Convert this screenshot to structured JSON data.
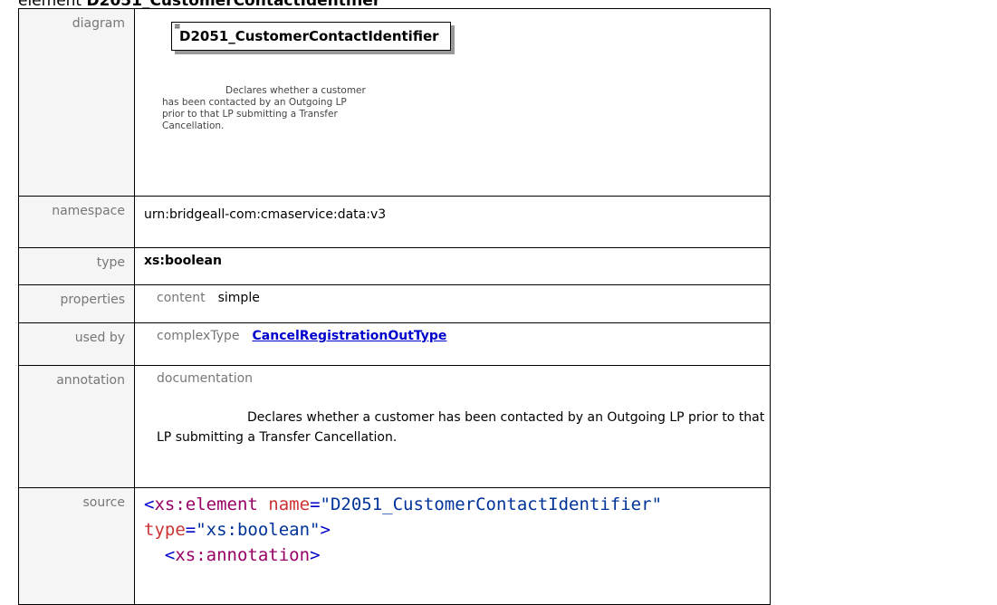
{
  "heading": {
    "prefix": "element ",
    "name": "D2051_CustomerContactIdentifier"
  },
  "rows": {
    "diagram": {
      "label": "diagram",
      "element_name": "D2051_CustomerContactIdentifier",
      "doc_text": "Declares whether a customer has been contacted by an Outgoing LP prior to that LP submitting a Transfer Cancellation."
    },
    "namespace": {
      "label": "namespace",
      "value": "urn:bridgeall-com:cmaservice:data:v3"
    },
    "type": {
      "label": "type",
      "value": "xs:boolean"
    },
    "properties": {
      "label": "properties",
      "key": "content",
      "value": "simple"
    },
    "used_by": {
      "label": "used by",
      "key": "complexType",
      "value": "CancelRegistrationOutType"
    },
    "annotation": {
      "label": "annotation",
      "key": "documentation",
      "text": "Declares whether a customer has been contacted by an Outgoing LP prior to that LP submitting a Transfer Cancellation."
    },
    "source": {
      "label": "source",
      "line1_open": "<",
      "line1_tag": "xs:element",
      "line1_attr1": "name",
      "line1_eq1": "=",
      "line1_val1": "\"D2051_CustomerContactIdentifier\"",
      "line2_attr2": "type",
      "line2_eq2": "=",
      "line2_val2": "\"xs:boolean\"",
      "line2_close": ">",
      "line3_open": "<",
      "line3_tag": "xs:annotation",
      "line3_close": ">"
    }
  }
}
